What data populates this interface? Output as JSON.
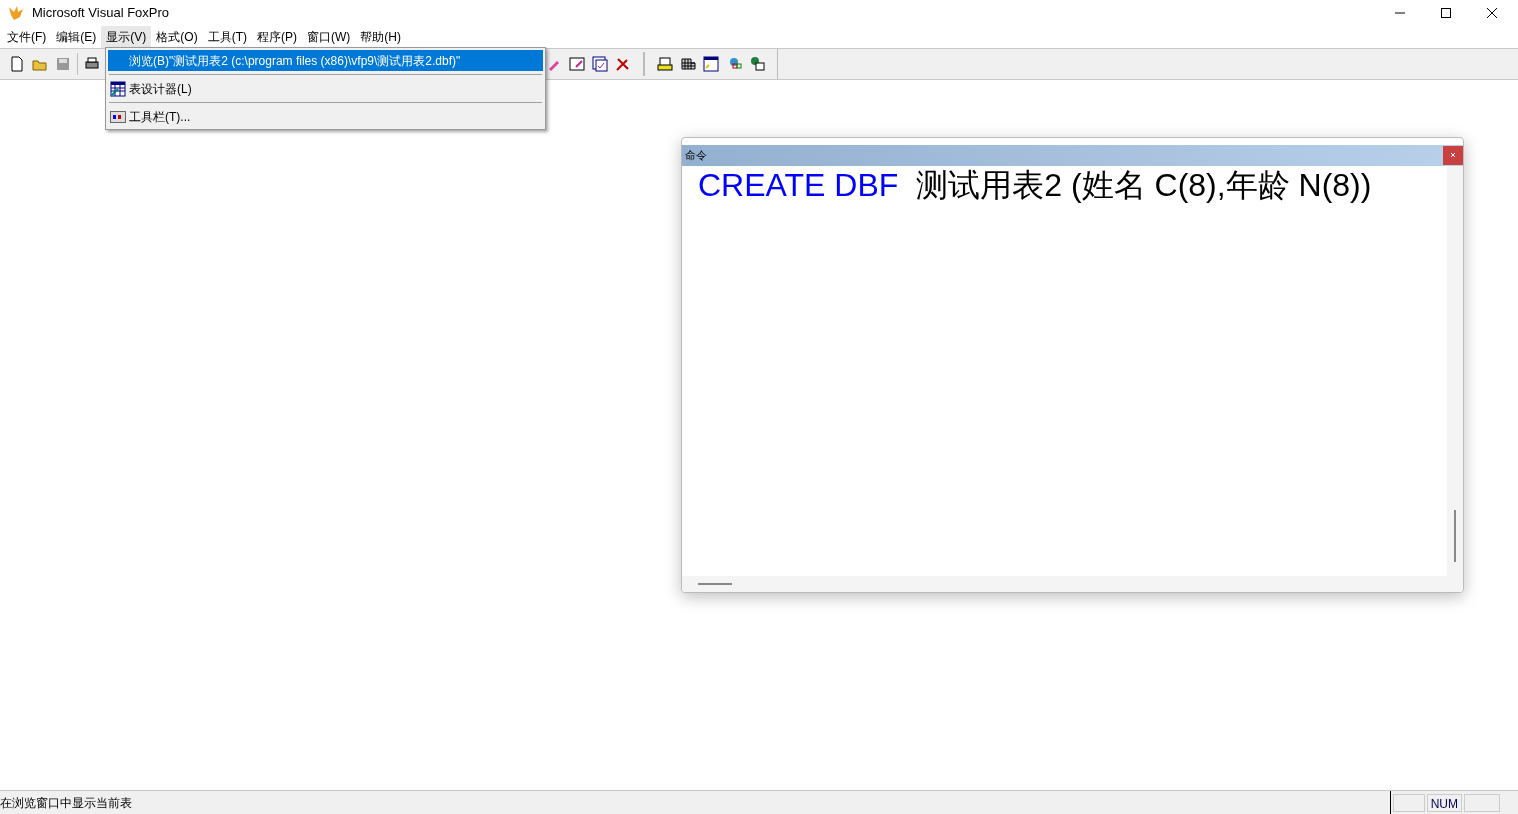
{
  "window": {
    "title": "Microsoft Visual FoxPro"
  },
  "menu_bar": [
    {
      "label": "文件(F)",
      "selected": false
    },
    {
      "label": "编辑(E)",
      "selected": false
    },
    {
      "label": "显示(V)",
      "selected": true
    },
    {
      "label": "格式(O)",
      "selected": false
    },
    {
      "label": "工具(T)",
      "selected": false
    },
    {
      "label": "程序(P)",
      "selected": false
    },
    {
      "label": "窗口(W)",
      "selected": false
    },
    {
      "label": "帮助(H)",
      "selected": false
    }
  ],
  "dropdown": [
    {
      "label": "浏览(B)\"测试用表2 (c:\\program files (x86)\\vfp9\\测试用表2.dbf)\"",
      "kind": "plain",
      "selected": true
    },
    {
      "label": "表设计器(L)",
      "kind": "designer",
      "selected": false
    },
    {
      "label": "工具栏(T)...",
      "kind": "toolbar",
      "selected": false
    }
  ],
  "command_window": {
    "title": "命令",
    "code": [
      {
        "text": "CREATE DBF",
        "kind": "keyword"
      },
      {
        "text": "测试用表2 (姓名 C(8),年龄 N(8))",
        "kind": "plain"
      }
    ]
  },
  "status_bar": {
    "message": "在浏览窗口中显示当前表",
    "indicators": [
      "NUM"
    ]
  }
}
